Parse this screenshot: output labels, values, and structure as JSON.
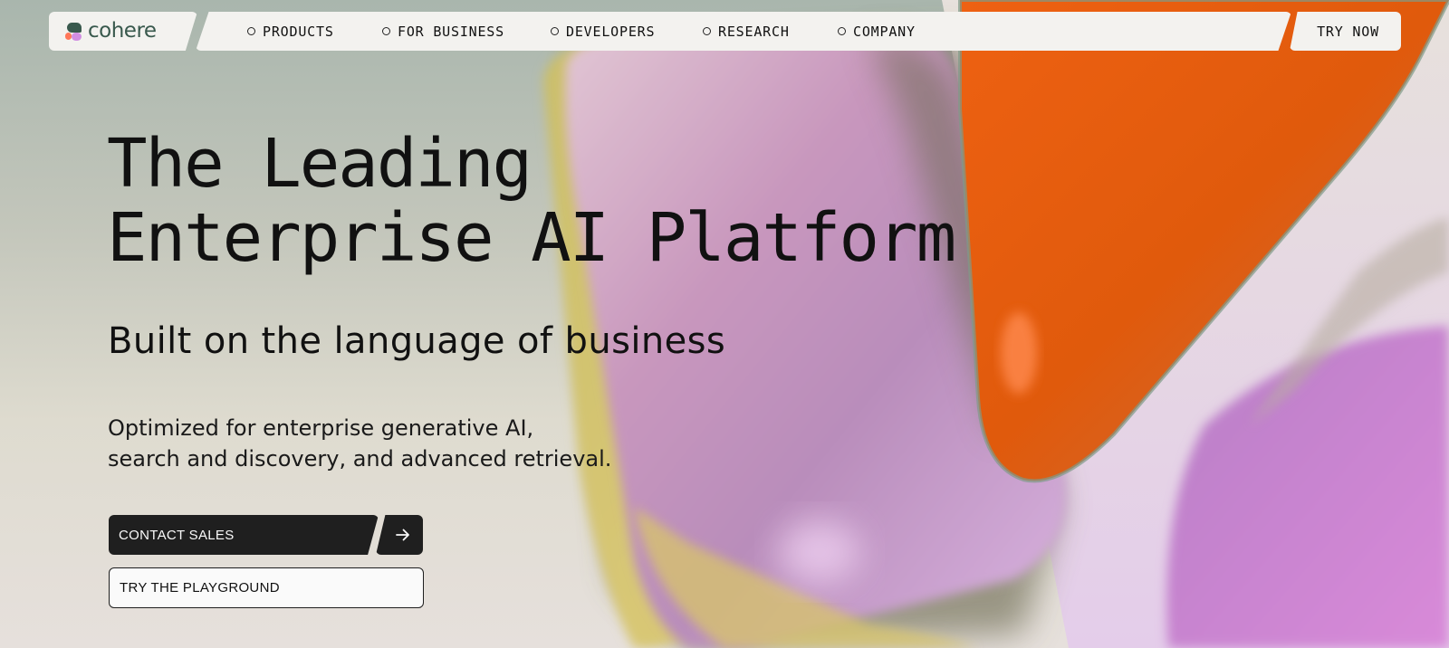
{
  "brand": {
    "name": "cohere",
    "colors": {
      "primary": "#39594d",
      "coral": "#ff7759",
      "lilac": "#d18ee2",
      "dark": "#1f1f1f",
      "nav_bg": "#f3f2ef"
    }
  },
  "nav": {
    "items": [
      {
        "label": "PRODUCTS",
        "icon": "circle-outline-icon"
      },
      {
        "label": "FOR BUSINESS",
        "icon": "circle-outline-icon"
      },
      {
        "label": "DEVELOPERS",
        "icon": "circle-outline-icon"
      },
      {
        "label": "RESEARCH",
        "icon": "circle-outline-icon"
      },
      {
        "label": "COMPANY",
        "icon": "circle-outline-icon"
      }
    ],
    "try_now": "TRY NOW"
  },
  "hero": {
    "title_line1": "The Leading",
    "title_line2": "Enterprise AI Platform",
    "subtitle": "Built on the language of business",
    "description_line1": "Optimized for enterprise generative AI,",
    "description_line2": "search and discovery, and advanced retrieval."
  },
  "cta": {
    "contact_sales": "CONTACT SALES",
    "arrow_icon": "arrow-right-icon",
    "playground": "TRY THE PLAYGROUND"
  }
}
